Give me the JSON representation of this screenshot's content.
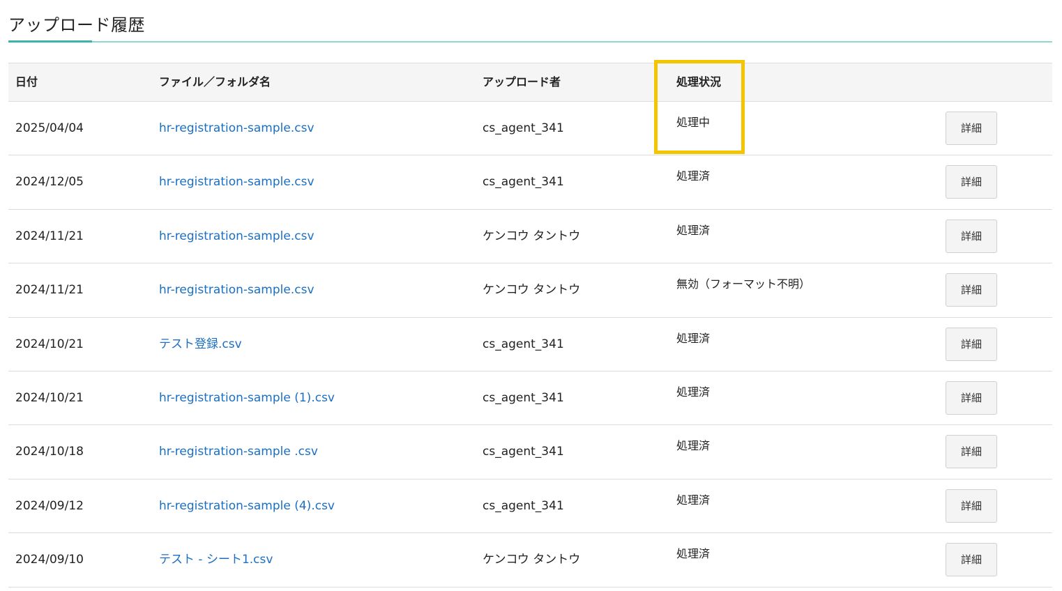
{
  "page": {
    "title": "アップロード履歴"
  },
  "table": {
    "headers": {
      "date": "日付",
      "file": "ファイル／フォルダ名",
      "uploader": "アップロード者",
      "status": "処理状況"
    },
    "detail_label": "詳細",
    "rows": [
      {
        "date": "2025/04/04",
        "file": "hr-registration-sample.csv",
        "uploader": "cs_agent_341",
        "status": "処理中"
      },
      {
        "date": "2024/12/05",
        "file": "hr-registration-sample.csv",
        "uploader": "cs_agent_341",
        "status": "処理済"
      },
      {
        "date": "2024/11/21",
        "file": "hr-registration-sample.csv",
        "uploader": "ケンコウ タントウ",
        "status": "処理済"
      },
      {
        "date": "2024/11/21",
        "file": "hr-registration-sample.csv",
        "uploader": "ケンコウ タントウ",
        "status": "無効（フォーマット不明）"
      },
      {
        "date": "2024/10/21",
        "file": "テスト登録.csv",
        "uploader": "cs_agent_341",
        "status": "処理済"
      },
      {
        "date": "2024/10/21",
        "file": "hr-registration-sample (1).csv",
        "uploader": "cs_agent_341",
        "status": "処理済"
      },
      {
        "date": "2024/10/18",
        "file": "hr-registration-sample .csv",
        "uploader": "cs_agent_341",
        "status": "処理済"
      },
      {
        "date": "2024/09/12",
        "file": "hr-registration-sample (4).csv",
        "uploader": "cs_agent_341",
        "status": "処理済"
      },
      {
        "date": "2024/09/10",
        "file": "テスト - シート1.csv",
        "uploader": "ケンコウ タントウ",
        "status": "処理済"
      }
    ]
  },
  "colors": {
    "link": "#1a6fc4",
    "highlight": "#f5c400",
    "title_rule": "#8fd6cf"
  }
}
